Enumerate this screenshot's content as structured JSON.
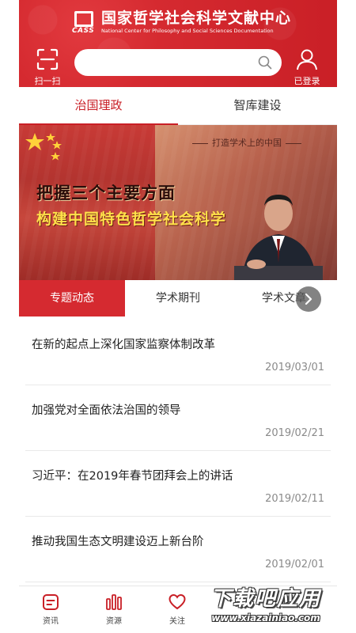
{
  "header": {
    "logo_cn": "国家哲学社会科学文献中心",
    "logo_en": "National Center for Philosophy and Social Sciences Documentation",
    "logo_abbr": "CASS",
    "scan_label": "扫一扫",
    "search_placeholder": "",
    "login_label": "已登录"
  },
  "top_tabs": [
    {
      "label": "治国理政",
      "active": true
    },
    {
      "label": "智库建设",
      "active": false
    }
  ],
  "banner": {
    "slogan": "打造学术上的中国",
    "title_line1": "把握三个主要方面",
    "title_line2": "构建中国特色哲学社会科学"
  },
  "sub_tabs": [
    {
      "label": "专题动态",
      "active": true
    },
    {
      "label": "学术期刊",
      "active": false
    },
    {
      "label": "学术文章",
      "active": false
    }
  ],
  "news": [
    {
      "title": "在新的起点上深化国家监察体制改革",
      "date": "2019/03/01"
    },
    {
      "title": "加强党对全面依法治国的领导",
      "date": "2019/02/21"
    },
    {
      "title": "习近平：在2019年春节团拜会上的讲话",
      "date": "2019/02/11"
    },
    {
      "title": "推动我国生态文明建设迈上新台阶",
      "date": "2019/02/01"
    }
  ],
  "bottom_nav": [
    {
      "label": "资讯",
      "icon": "news-icon"
    },
    {
      "label": "资源",
      "icon": "resources-icon"
    },
    {
      "label": "关注",
      "icon": "heart-icon"
    }
  ],
  "watermark": {
    "line1": "下载吧应用",
    "line2": "www.xiazainiao.com"
  },
  "colors": {
    "brand_red": "#c91f26",
    "active_tab_bg": "#d52a30",
    "date_gray": "#8a8a8a"
  }
}
